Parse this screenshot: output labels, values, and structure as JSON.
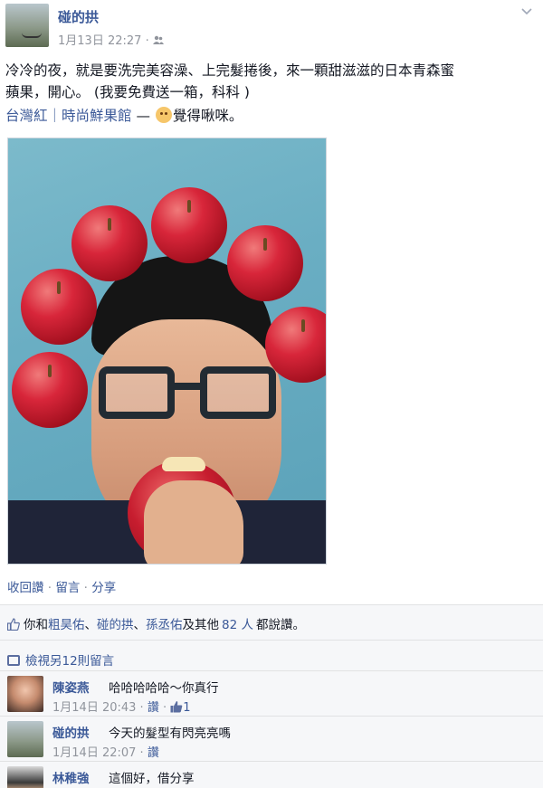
{
  "post": {
    "author": "碰的拱",
    "date": "1月13日 22:27",
    "audience_icon": "friends-icon",
    "text_line1": "冷冷的夜，就是要洗完美容澡、上完髮捲後，來一顆甜滋滋的日本青森蜜",
    "text_line2": "蘋果，開心。 (我要免費送一箱，科科 )",
    "checkin_place": "台灣紅｜時尚鮮果館",
    "checkin_dash": " — ",
    "feeling": "覺得啾咪。"
  },
  "actions": {
    "unlike": "收回讚",
    "comment": "留言",
    "share": "分享",
    "dot": " · "
  },
  "likes": {
    "prefix": "你和",
    "name1": "粗昊佑",
    "sep1": "、",
    "name2": "碰的拱",
    "sep2": "、",
    "name3": "孫丞佑",
    "and_others": "及其他",
    "count": "82 人",
    "suffix": "都說讚。"
  },
  "view_more": "檢視另12則留言",
  "comments": [
    {
      "author": "陳姿燕",
      "text": "哈哈哈哈哈～你真行",
      "date": "1月14日 20:43",
      "like_label": "讚",
      "likes": "1"
    },
    {
      "author": "碰的拱",
      "text": "今天的髮型有閃亮亮嗎",
      "date": "1月14日 22:07",
      "like_label": "讚"
    },
    {
      "author": "林稚強",
      "text": "這個好，借分享"
    }
  ],
  "colors": {
    "link": "#3b5998",
    "meta": "#90949c",
    "ufi_bg": "#f6f7f9"
  }
}
